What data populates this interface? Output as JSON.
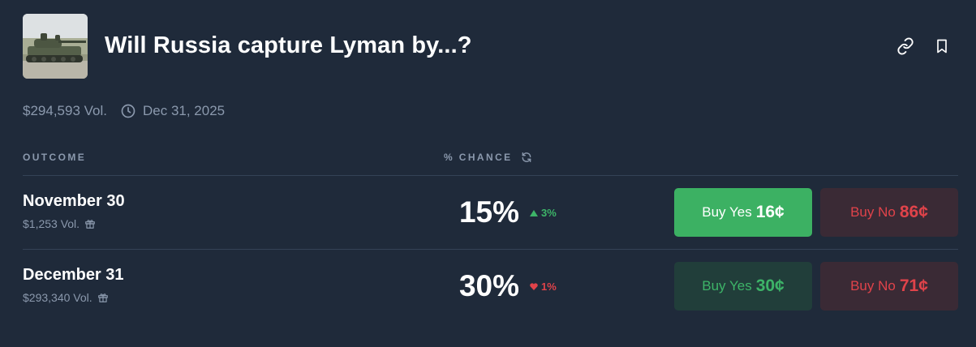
{
  "market": {
    "title": "Will Russia capture Lyman by...?",
    "volume": "$294,593 Vol.",
    "end_date": "Dec 31, 2025",
    "icons": {
      "link": "link-icon",
      "bookmark": "bookmark-icon",
      "clock": "clock-icon",
      "refresh": "refresh-icon",
      "gift": "gift-icon"
    }
  },
  "table": {
    "outcome_header": "OUTCOME",
    "chance_header": "% CHANCE",
    "rows": [
      {
        "name": "November 30",
        "volume": "$1,253 Vol.",
        "chance": "15%",
        "delta": "3%",
        "delta_direction": "up",
        "buy_yes_label": "Buy Yes",
        "buy_yes_price": "16¢",
        "buy_no_label": "Buy No",
        "buy_no_price": "86¢"
      },
      {
        "name": "December 31",
        "volume": "$293,340 Vol.",
        "chance": "30%",
        "delta": "1%",
        "delta_direction": "down",
        "buy_yes_label": "Buy Yes",
        "buy_yes_price": "30¢",
        "buy_no_label": "Buy No",
        "buy_no_price": "71¢"
      }
    ]
  },
  "colors": {
    "background": "#1f2a3a",
    "muted_text": "#8b99ad",
    "green": "#3db468",
    "red": "#e0434a"
  }
}
